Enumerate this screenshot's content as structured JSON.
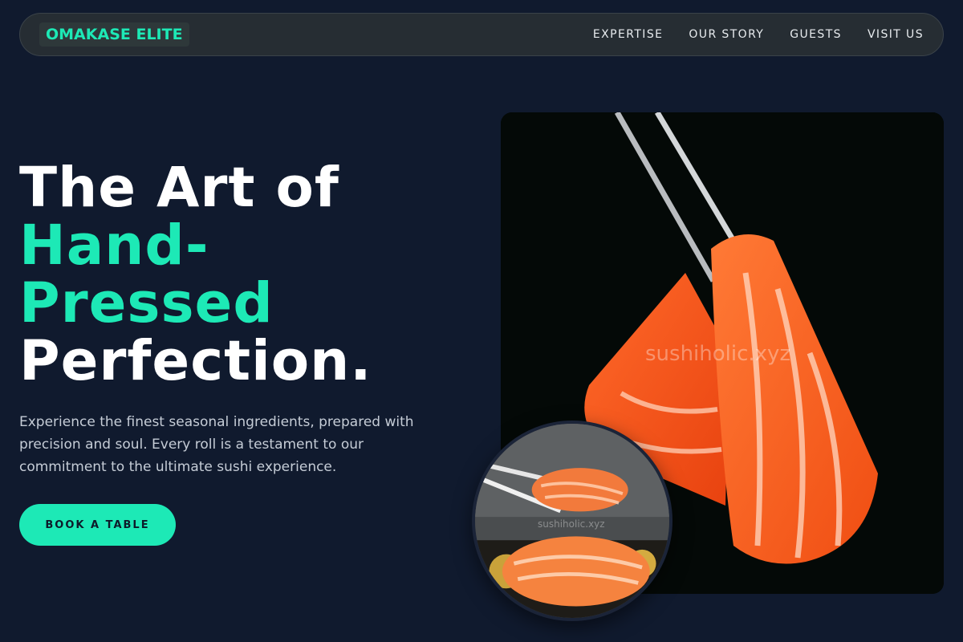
{
  "brand": {
    "name": "OMAKASE ELITE",
    "accent": "#1de9b6",
    "background": "#101a2e"
  },
  "nav": {
    "links": [
      {
        "label": "EXPERTISE"
      },
      {
        "label": "OUR STORY"
      },
      {
        "label": "GUESTS"
      },
      {
        "label": "VISIT US"
      }
    ]
  },
  "hero": {
    "title_line1": "The Art of",
    "title_accent1": "Hand-",
    "title_accent2": "Pressed",
    "title_line3": "Perfection.",
    "description": "Experience the finest seasonal ingredients, prepared with precision and soul. Every roll is a testament to our commitment to the ultimate sushi experience.",
    "cta_label": "BOOK A TABLE"
  },
  "images": {
    "main": {
      "subject": "salmon-sashimi-chopsticks",
      "watermark": "sushiholic.xyz"
    },
    "inset": {
      "subject": "salmon-nigiri-chopsticks",
      "watermark": "sushiholic.xyz"
    }
  }
}
